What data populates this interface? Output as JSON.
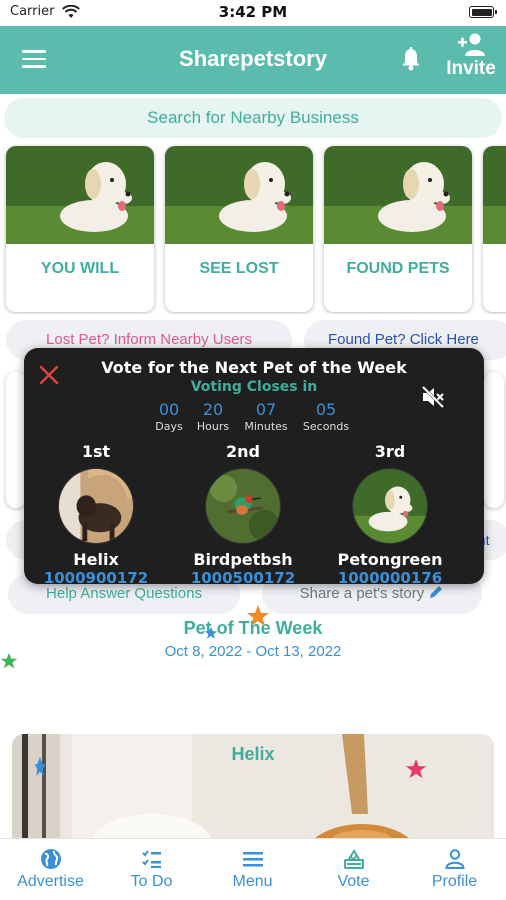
{
  "status_bar": {
    "carrier": "Carrier",
    "time": "3:42 PM"
  },
  "header": {
    "title": "Sharepetstory",
    "invite_label": "Invite"
  },
  "search": {
    "label": "Search for Nearby Business"
  },
  "cards": [
    {
      "label": "YOU WILL"
    },
    {
      "label": "SEE LOST"
    },
    {
      "label": "FOUND PETS"
    }
  ],
  "links": {
    "lost_pet": "Lost Pet? Inform Nearby Users",
    "found_pet": "Found Pet? Click Here",
    "mid_right": "unt",
    "help": "Help Answer Questions",
    "share": "Share a pet's story"
  },
  "vote_popup": {
    "title": "Vote for the Next Pet of the Week",
    "closes_label": "Voting Closes in",
    "countdown": [
      {
        "value": "00",
        "unit": "Days"
      },
      {
        "value": "20",
        "unit": "Hours"
      },
      {
        "value": "07",
        "unit": "Minutes"
      },
      {
        "value": "05",
        "unit": "Seconds"
      }
    ],
    "ranks": [
      {
        "place": "1st",
        "name": "Helix",
        "id": "1000900172"
      },
      {
        "place": "2nd",
        "name": "Birdpetbsh",
        "id": "1000500172"
      },
      {
        "place": "3rd",
        "name": "Petongreen",
        "id": "1000000176"
      }
    ]
  },
  "pet_of_week": {
    "title": "Pet of The Week",
    "dates": "Oct 8, 2022 - Oct 13, 2022",
    "pet_name": "Helix"
  },
  "bottom_nav": [
    {
      "label": "Advertise",
      "icon": "globe-icon"
    },
    {
      "label": "To Do",
      "icon": "checklist-icon"
    },
    {
      "label": "Menu",
      "icon": "menu-icon"
    },
    {
      "label": "Vote",
      "icon": "vote-icon"
    },
    {
      "label": "Profile",
      "icon": "profile-icon"
    }
  ],
  "colors": {
    "brand": "#5bbcae",
    "accent_text": "#3fae9c",
    "link_blue": "#3a8fd9",
    "lost_pink": "#e05a8a"
  }
}
